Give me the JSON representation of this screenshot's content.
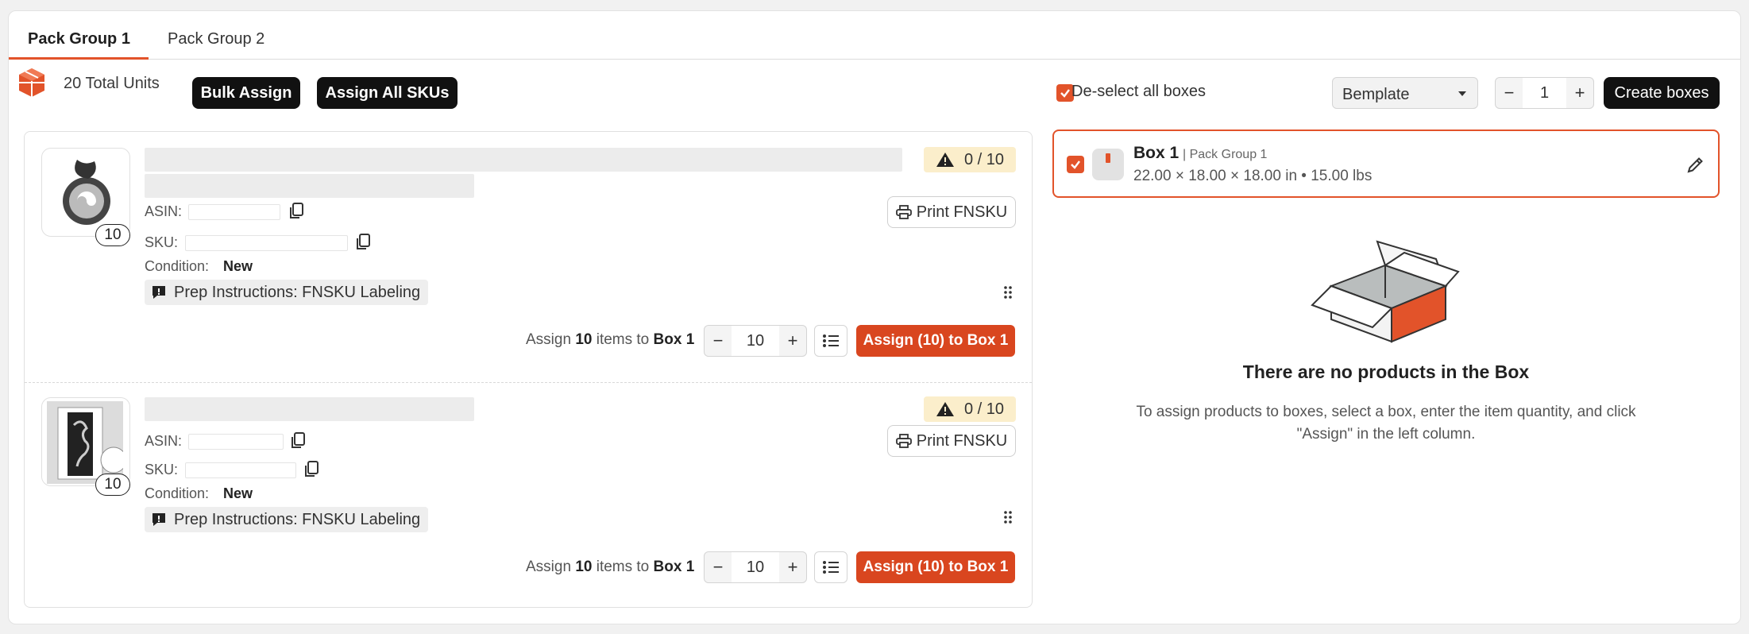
{
  "tabs": [
    {
      "label": "Pack Group 1",
      "active": true
    },
    {
      "label": "Pack Group 2",
      "active": false
    }
  ],
  "toolbar": {
    "total_units": "20 Total Units",
    "bulk_assign": "Bulk Assign",
    "assign_all": "Assign All SKUs",
    "deselect_label": "De-select all boxes",
    "template_selected": "Bemplate",
    "box_count": "1",
    "create_boxes": "Create boxes"
  },
  "products": [
    {
      "quantity": "10",
      "progress": "0 / 10",
      "asin_label": "ASIN:",
      "sku_label": "SKU:",
      "condition_label": "Condition:",
      "condition": "New",
      "prep": "Prep Instructions: FNSKU Labeling",
      "print": "Print FNSKU",
      "assign_prefix": "Assign",
      "assign_qty": "10",
      "assign_mid": "items to",
      "assign_box": "Box 1",
      "stepper_value": "10",
      "assign_button": "Assign (10) to Box 1"
    },
    {
      "quantity": "10",
      "progress": "0 / 10",
      "asin_label": "ASIN:",
      "sku_label": "SKU:",
      "condition_label": "Condition:",
      "condition": "New",
      "prep": "Prep Instructions: FNSKU Labeling",
      "print": "Print FNSKU",
      "assign_prefix": "Assign",
      "assign_qty": "10",
      "assign_mid": "items to",
      "assign_box": "Box 1",
      "stepper_value": "10",
      "assign_button": "Assign (10) to Box 1"
    }
  ],
  "box": {
    "title": "Box 1",
    "group": "| Pack Group 1",
    "dims": "22.00 × 18.00 × 18.00 in • 15.00 lbs"
  },
  "empty": {
    "title": "There are no products in the Box",
    "desc_line1": "To assign products to boxes, select a box, enter the item quantity, and click",
    "desc_line2": "\"Assign\" in the left column."
  },
  "colors": {
    "accent": "#e2532a",
    "assign_red": "#d9461f",
    "warning_bg": "#fbeecb"
  }
}
